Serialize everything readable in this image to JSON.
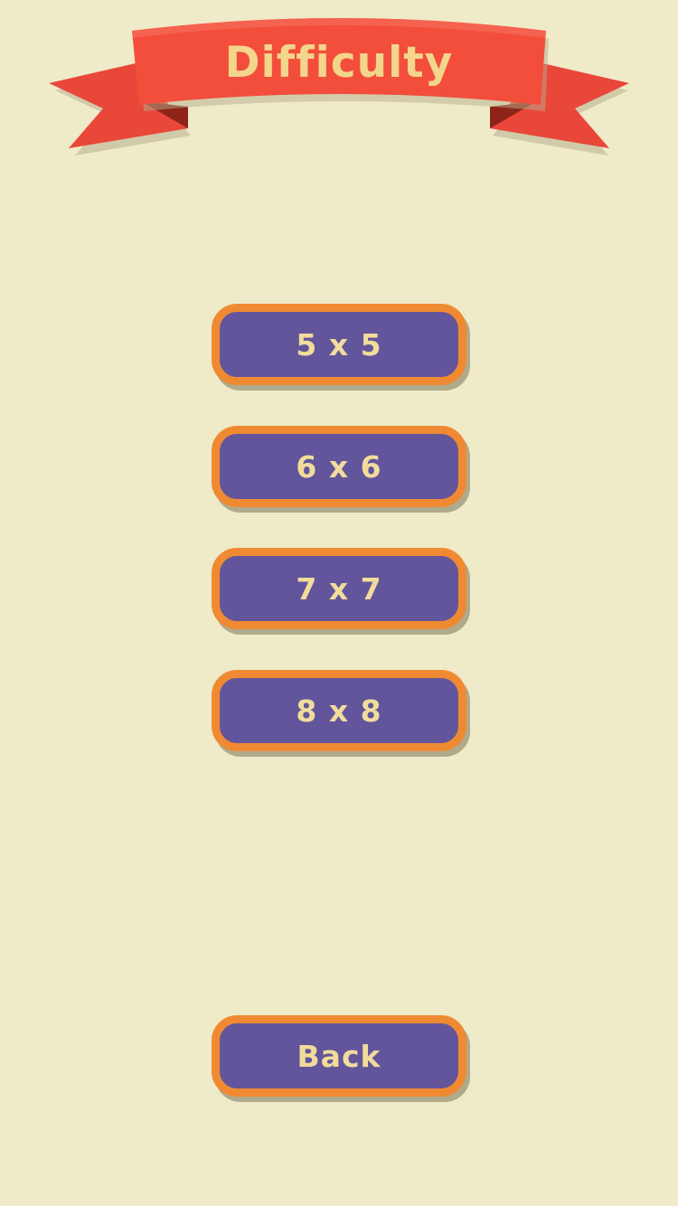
{
  "header": {
    "title": "Difficulty"
  },
  "difficulty_options": [
    {
      "label": "5 x 5"
    },
    {
      "label": "6 x 6"
    },
    {
      "label": "7 x 7"
    },
    {
      "label": "8 x 8"
    }
  ],
  "footer": {
    "back_label": "Back"
  },
  "colors": {
    "background": "#efeac8",
    "ribbon": "#f24e3b",
    "ribbon_title": "#f3d58c",
    "button_fill": "#62559b",
    "button_border": "#ef8a33",
    "button_text": "#f1dc9c"
  }
}
